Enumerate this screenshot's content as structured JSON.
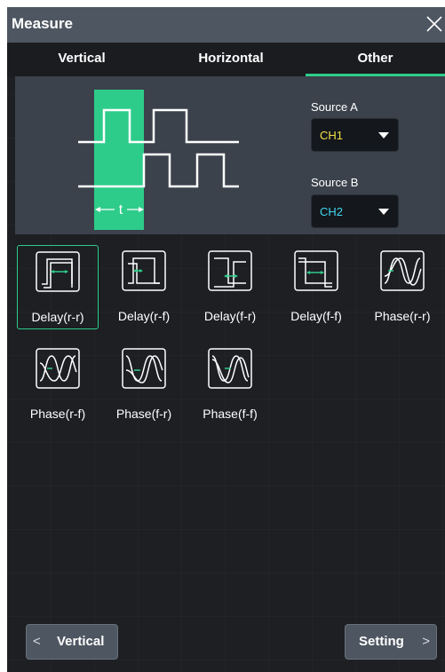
{
  "window": {
    "title": "Measure"
  },
  "tabs": [
    {
      "label": "Vertical",
      "active": false
    },
    {
      "label": "Horizontal",
      "active": false
    },
    {
      "label": "Other",
      "active": true
    }
  ],
  "diagram": {
    "time_label": "t"
  },
  "sources": {
    "a": {
      "label": "Source A",
      "value": "CH1",
      "color": "#f2e14a"
    },
    "b": {
      "label": "Source B",
      "value": "CH2",
      "color": "#3fd6ee"
    }
  },
  "items": [
    {
      "label": "Delay(r-r)",
      "icon": "delay-rr-icon",
      "selected": true
    },
    {
      "label": "Delay(r-f)",
      "icon": "delay-rf-icon",
      "selected": false
    },
    {
      "label": "Delay(f-r)",
      "icon": "delay-fr-icon",
      "selected": false
    },
    {
      "label": "Delay(f-f)",
      "icon": "delay-ff-icon",
      "selected": false
    },
    {
      "label": "Phase(r-r)",
      "icon": "phase-rr-icon",
      "selected": false
    },
    {
      "label": "Phase(r-f)",
      "icon": "phase-rf-icon",
      "selected": false
    },
    {
      "label": "Phase(f-r)",
      "icon": "phase-fr-icon",
      "selected": false
    },
    {
      "label": "Phase(f-f)",
      "icon": "phase-ff-icon",
      "selected": false
    }
  ],
  "footer": {
    "back_label": "Vertical",
    "setting_label": "Setting"
  },
  "colors": {
    "accent": "#2ecc8a",
    "panel": "#3b424c",
    "background": "#1d1f23"
  }
}
